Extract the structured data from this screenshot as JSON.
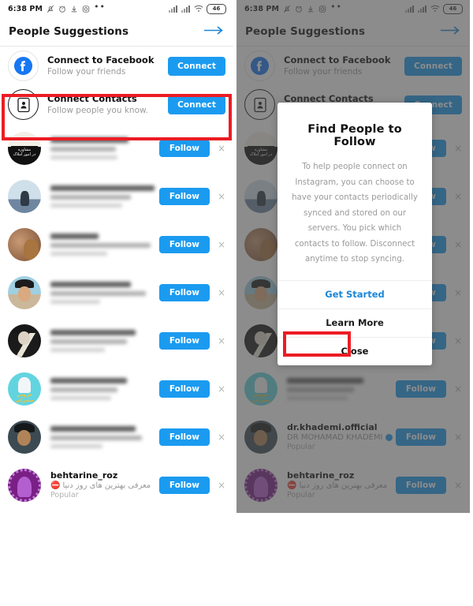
{
  "statusbar": {
    "time": "6:38 PM",
    "battery_level": "46",
    "icons": [
      "bell-muted-icon",
      "alarm-clock-icon",
      "download-icon",
      "instagram-icon",
      "more-dots-icon"
    ],
    "right_icons": [
      "signal-bars-icon",
      "signal-bars-icon",
      "wifi-icon",
      "battery-icon"
    ]
  },
  "header": {
    "title": "People Suggestions",
    "next_arrow": "arrow-right-icon"
  },
  "connect": {
    "facebook": {
      "title": "Connect to Facebook",
      "subtitle": "Follow your friends",
      "button": "Connect",
      "icon": "facebook-icon"
    },
    "contacts": {
      "title": "Connect Contacts",
      "subtitle": "Follow people you know.",
      "button": "Connect",
      "icon": "contact-card-icon"
    }
  },
  "suggestions": {
    "follow_label": "Follow",
    "dismiss_label": "×",
    "rows": [
      {
        "blurred": true,
        "avatar": "av-a"
      },
      {
        "blurred": true,
        "avatar": "av-b"
      },
      {
        "blurred": true,
        "avatar": "av-c"
      },
      {
        "blurred": true,
        "avatar": "av-d"
      },
      {
        "blurred": true,
        "avatar": "av-e"
      },
      {
        "blurred": true,
        "avatar": "av-f"
      },
      {
        "blurred": true,
        "avatar": "av-g"
      },
      {
        "username": "behtarine_roz",
        "fullname": "معرفی بهترین های روز دنیا",
        "meta": "Popular",
        "avatar": "av-h"
      }
    ],
    "right_rows": [
      {
        "username": "dr.khademi.official",
        "fullname": "DR MOHAMAD KHADEMI",
        "meta": "Popular",
        "verified": true,
        "avatar": "av-g"
      },
      {
        "username": "behtarine_roz",
        "fullname": "معرفی بهترین های روز دنیا",
        "meta": "Popular",
        "avatar": "av-h"
      }
    ]
  },
  "modal": {
    "title": "Find People to Follow",
    "body": "To help people connect on Instagram, you can choose to have your contacts periodically synced and stored on our servers. You pick which contacts to follow. Disconnect anytime to stop syncing.",
    "primary_button": "Get Started",
    "secondary_button": "Learn More",
    "close_button": "Close"
  },
  "colors": {
    "accent_blue": "#1b9bf0",
    "highlight_red": "#ec1c24",
    "text_dark": "#111111",
    "text_muted": "#9a9a9a"
  }
}
